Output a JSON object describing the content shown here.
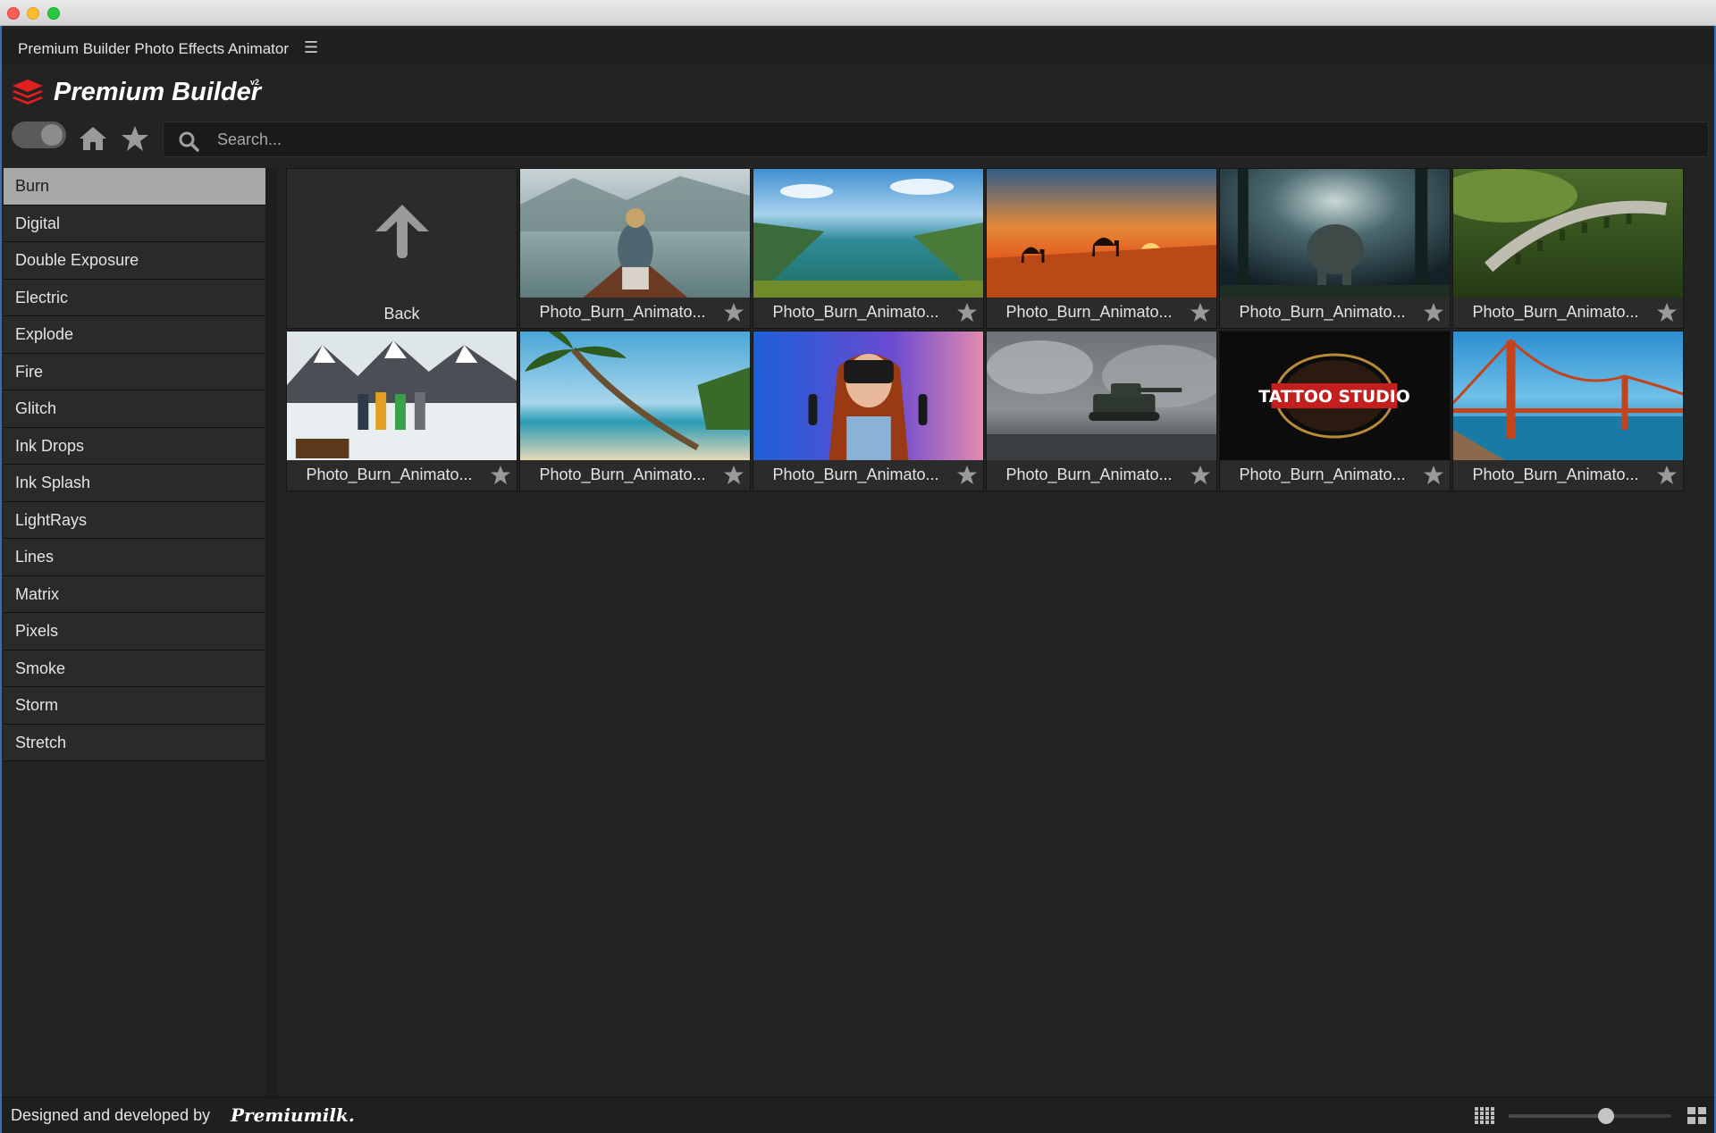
{
  "window": {
    "title": "Premium Builder Photo Effects Animator"
  },
  "brand": {
    "name": "Premium Builder",
    "version": "v2",
    "accent_color": "#e0201f"
  },
  "toolbar": {
    "toggle_state": "off",
    "search_placeholder": "Search..."
  },
  "sidebar": {
    "items": [
      {
        "label": "Burn",
        "active": true
      },
      {
        "label": "Digital",
        "active": false
      },
      {
        "label": "Double Exposure",
        "active": false
      },
      {
        "label": "Electric",
        "active": false
      },
      {
        "label": "Explode",
        "active": false
      },
      {
        "label": "Fire",
        "active": false
      },
      {
        "label": "Glitch",
        "active": false
      },
      {
        "label": "Ink Drops",
        "active": false
      },
      {
        "label": "Ink Splash",
        "active": false
      },
      {
        "label": "LightRays",
        "active": false
      },
      {
        "label": "Lines",
        "active": false
      },
      {
        "label": "Matrix",
        "active": false
      },
      {
        "label": "Pixels",
        "active": false
      },
      {
        "label": "Smoke",
        "active": false
      },
      {
        "label": "Storm",
        "active": false
      },
      {
        "label": "Stretch",
        "active": false
      }
    ]
  },
  "grid": {
    "back_label": "Back",
    "tiles": [
      {
        "label": "Photo_Burn_Animato...",
        "thumb": "woman-in-canoe-lake",
        "favorite": false
      },
      {
        "label": "Photo_Burn_Animato...",
        "thumb": "mountain-lake-aerial",
        "favorite": false
      },
      {
        "label": "Photo_Burn_Animato...",
        "thumb": "desert-camels-sunset",
        "favorite": false
      },
      {
        "label": "Photo_Burn_Animato...",
        "thumb": "elephant-in-forest",
        "favorite": false
      },
      {
        "label": "Photo_Burn_Animato...",
        "thumb": "railway-viaduct-hills",
        "favorite": false
      },
      {
        "label": "Photo_Burn_Animato...",
        "thumb": "hikers-snowy-mountains",
        "favorite": false
      },
      {
        "label": "Photo_Burn_Animato...",
        "thumb": "palm-tree-beach",
        "favorite": false
      },
      {
        "label": "Photo_Burn_Animato...",
        "thumb": "woman-vr-headset",
        "favorite": false
      },
      {
        "label": "Photo_Burn_Animato...",
        "thumb": "tank-battlefield-smoke",
        "favorite": false
      },
      {
        "label": "Photo_Burn_Animato...",
        "thumb": "tattoo-studio-logo",
        "favorite": false,
        "text": "TATTOO STUDIO"
      },
      {
        "label": "Photo_Burn_Animato...",
        "thumb": "golden-gate-bridge",
        "favorite": false
      }
    ]
  },
  "footer": {
    "credit_text": "Designed and developed by",
    "credit_brand": "Premiumilk.",
    "thumb_size_percent": 60
  }
}
